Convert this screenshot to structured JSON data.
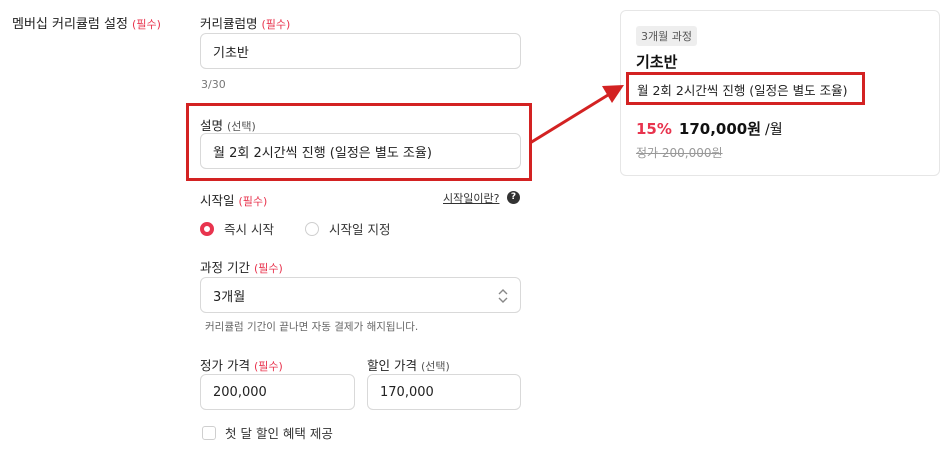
{
  "section": {
    "title": "멤버십 커리큘럼 설정",
    "required": "(필수)"
  },
  "curriculum_name": {
    "label": "커리큘럼명",
    "required": "(필수)",
    "value": "기초반",
    "counter": "3/30"
  },
  "description": {
    "label": "설명",
    "optional": "(선택)",
    "value": "월 2회 2시간씩 진행 (일정은 별도 조율)"
  },
  "start_date": {
    "label": "시작일",
    "required": "(필수)",
    "help_link": "시작일이란?",
    "options": [
      {
        "label": "즉시 시작",
        "selected": true
      },
      {
        "label": "시작일 지정",
        "selected": false
      }
    ]
  },
  "course_period": {
    "label": "과정 기간",
    "required": "(필수)",
    "value": "3개월",
    "hint": "커리큘럼 기간이 끝나면 자동 결제가 해지됩니다."
  },
  "regular_price": {
    "label": "정가 가격",
    "required": "(필수)",
    "value": "200,000"
  },
  "discount_price": {
    "label": "할인 가격",
    "optional": "(선택)",
    "value": "170,000"
  },
  "first_month": {
    "label": "첫 달 할인 혜택 제공",
    "checked": false
  },
  "preview": {
    "badge": "3개월 과정",
    "title": "기초반",
    "description": "월 2회 2시간씩 진행 (일정은 별도 조율)",
    "discount_rate": "15%",
    "price": "170,000원",
    "per": "/월",
    "original_price": "정가 200,000원"
  },
  "colors": {
    "accent": "#e8344e",
    "highlight": "#d32222"
  },
  "icons": [
    "question-icon",
    "chevron-updown-icon",
    "arrow-icon"
  ]
}
